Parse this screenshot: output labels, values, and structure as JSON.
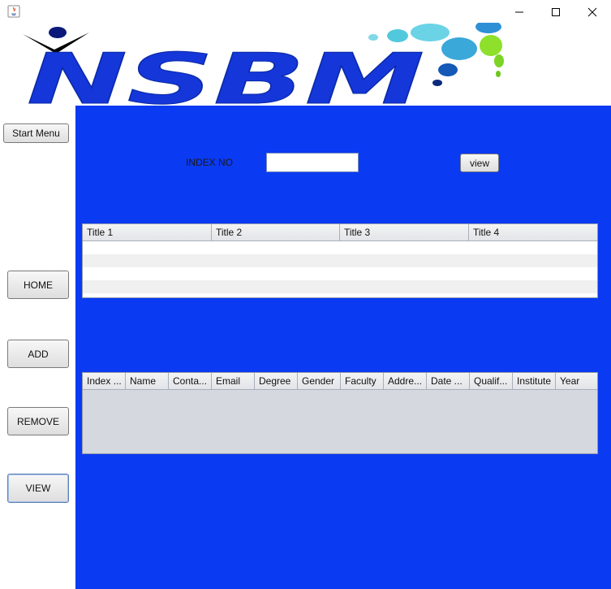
{
  "window": {
    "controls": [
      "minimize-icon",
      "maximize-icon",
      "close-icon"
    ]
  },
  "logo": {
    "text": "NSBM",
    "color": "#1536d8"
  },
  "sidebar": {
    "start_menu": "Start Menu",
    "home": "HOME",
    "add": "ADD",
    "remove": "REMOVE",
    "view": "VIEW"
  },
  "search": {
    "label": "INDEX NO",
    "value": "",
    "button": "view"
  },
  "table1": {
    "columns": [
      "Title 1",
      "Title 2",
      "Title 3",
      "Title 4"
    ]
  },
  "table2": {
    "columns": [
      "Index ...",
      "Name",
      "Conta...",
      "Email",
      "Degree",
      "Gender",
      "Faculty",
      "Addre...",
      "Date ...",
      "Qualif...",
      "Institute",
      "Year"
    ]
  },
  "colors": {
    "panel": "#0a3af2",
    "logo": "#1536d8"
  }
}
